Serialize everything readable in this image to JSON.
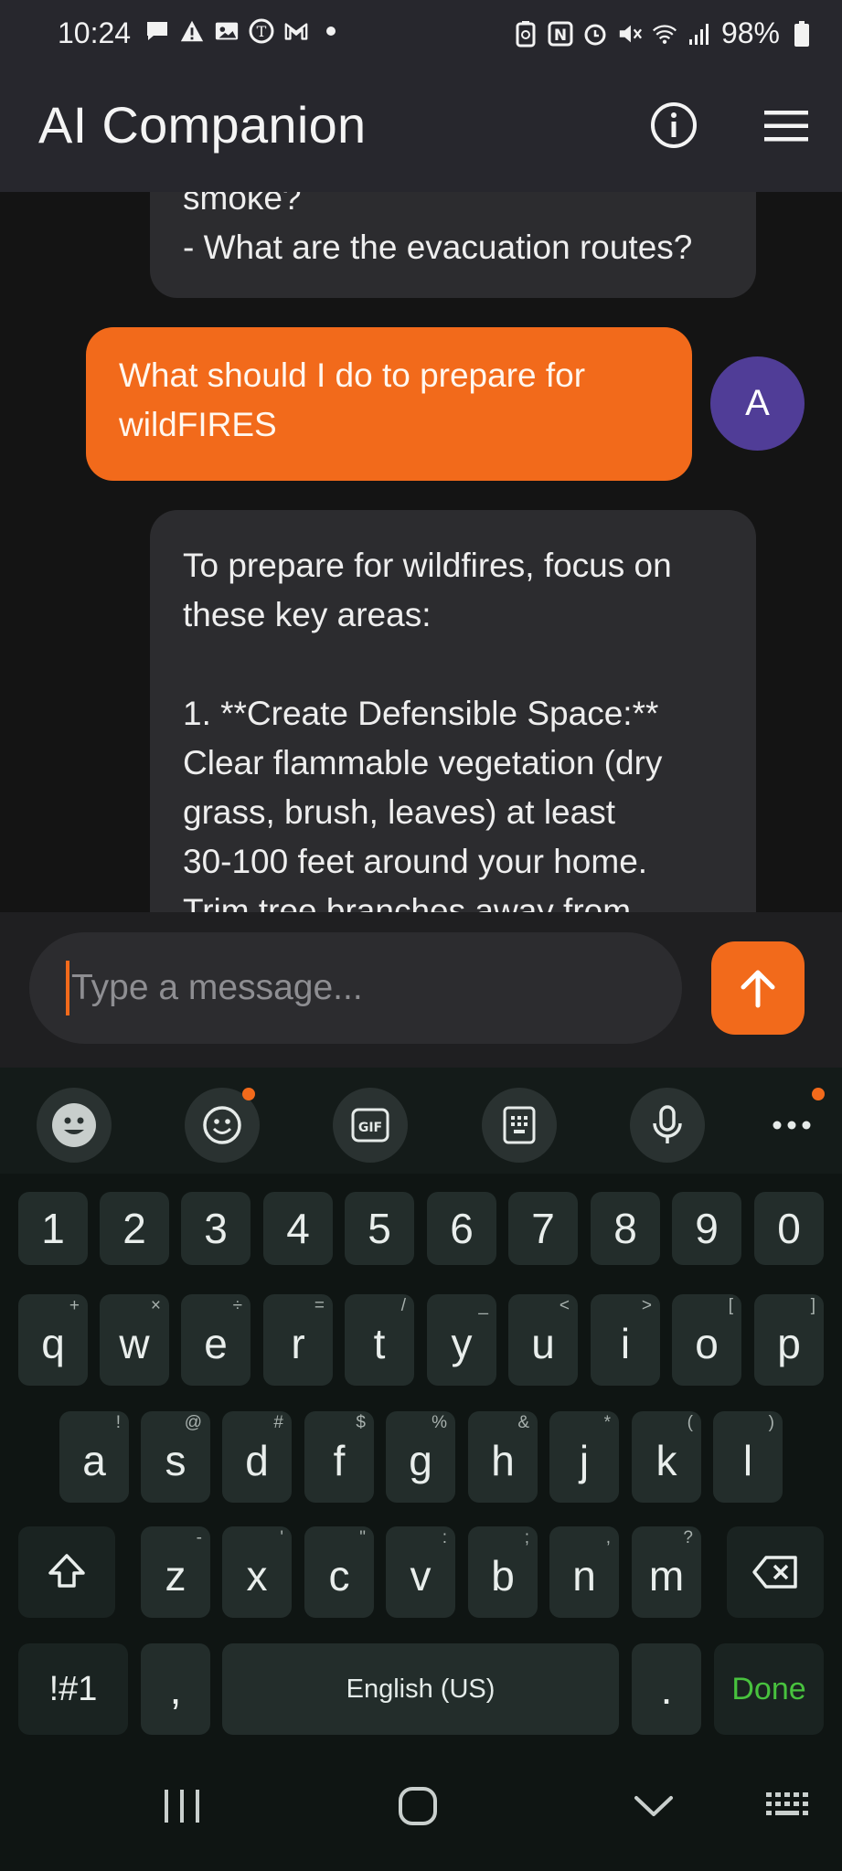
{
  "status_bar": {
    "time": "10:24",
    "battery_text": "98%",
    "left_icons": [
      "chat-icon",
      "warning-icon",
      "image-icon",
      "news-icon",
      "gmail-icon",
      "dot-icon"
    ],
    "right_icons": [
      "battery-saver-icon",
      "nfc-icon",
      "alarm-icon",
      "mute-icon",
      "wifi-icon",
      "signal-icon",
      "battery-icon"
    ]
  },
  "app_bar": {
    "title": "AI Companion",
    "info_icon": "info-icon",
    "menu_icon": "hamburger-menu-icon"
  },
  "chat": {
    "messages": [
      {
        "role": "assistant",
        "lines": [
          "smoke?",
          "- What are the evacuation routes?"
        ]
      },
      {
        "role": "user",
        "lines": [
          "What should I do to prepare for",
          "wildFIRES"
        ],
        "avatar": "A"
      },
      {
        "role": "assistant",
        "lines": [
          "To prepare for wildfires, focus on",
          "these key areas:",
          "",
          "1.  **Create Defensible Space:**",
          "Clear flammable vegetation (dry",
          "grass, brush, leaves) at least",
          "30-100 feet around your home.",
          "Trim tree branches away from"
        ]
      }
    ]
  },
  "composer": {
    "placeholder": "Type a message...",
    "send_icon": "arrow-up-icon"
  },
  "keyboard": {
    "toolbar_icons": [
      "emoji-face-icon",
      "sticker-icon",
      "gif-icon",
      "clipboard-icon",
      "microphone-icon",
      "more-icon"
    ],
    "numbers": [
      "1",
      "2",
      "3",
      "4",
      "5",
      "6",
      "7",
      "8",
      "9",
      "0"
    ],
    "row1": [
      {
        "k": "q",
        "a": "+"
      },
      {
        "k": "w",
        "a": "×"
      },
      {
        "k": "e",
        "a": "÷"
      },
      {
        "k": "r",
        "a": "="
      },
      {
        "k": "t",
        "a": "/"
      },
      {
        "k": "y",
        "a": "_"
      },
      {
        "k": "u",
        "a": "<"
      },
      {
        "k": "i",
        "a": ">"
      },
      {
        "k": "o",
        "a": "["
      },
      {
        "k": "p",
        "a": "]"
      }
    ],
    "row2": [
      {
        "k": "a",
        "a": "!"
      },
      {
        "k": "s",
        "a": "@"
      },
      {
        "k": "d",
        "a": "#"
      },
      {
        "k": "f",
        "a": "$"
      },
      {
        "k": "g",
        "a": "%"
      },
      {
        "k": "h",
        "a": "&"
      },
      {
        "k": "j",
        "a": "*"
      },
      {
        "k": "k",
        "a": "("
      },
      {
        "k": "l",
        "a": ")"
      }
    ],
    "row3": [
      {
        "k": "z",
        "a": "-"
      },
      {
        "k": "x",
        "a": "'"
      },
      {
        "k": "c",
        "a": "\""
      },
      {
        "k": "v",
        "a": ":"
      },
      {
        "k": "b",
        "a": ";"
      },
      {
        "k": "n",
        "a": ","
      },
      {
        "k": "m",
        "a": "?"
      }
    ],
    "symbols_label": "!#1",
    "comma_label": ",",
    "space_label": "English (US)",
    "period_label": ".",
    "done_label": "Done"
  },
  "nav_bar": {
    "icons": [
      "recents-icon",
      "home-icon",
      "back-chevron-icon",
      "keyboard-switch-icon"
    ]
  },
  "colors": {
    "accent": "#f26a1b",
    "avatar": "#503d97",
    "done": "#48c23e"
  }
}
